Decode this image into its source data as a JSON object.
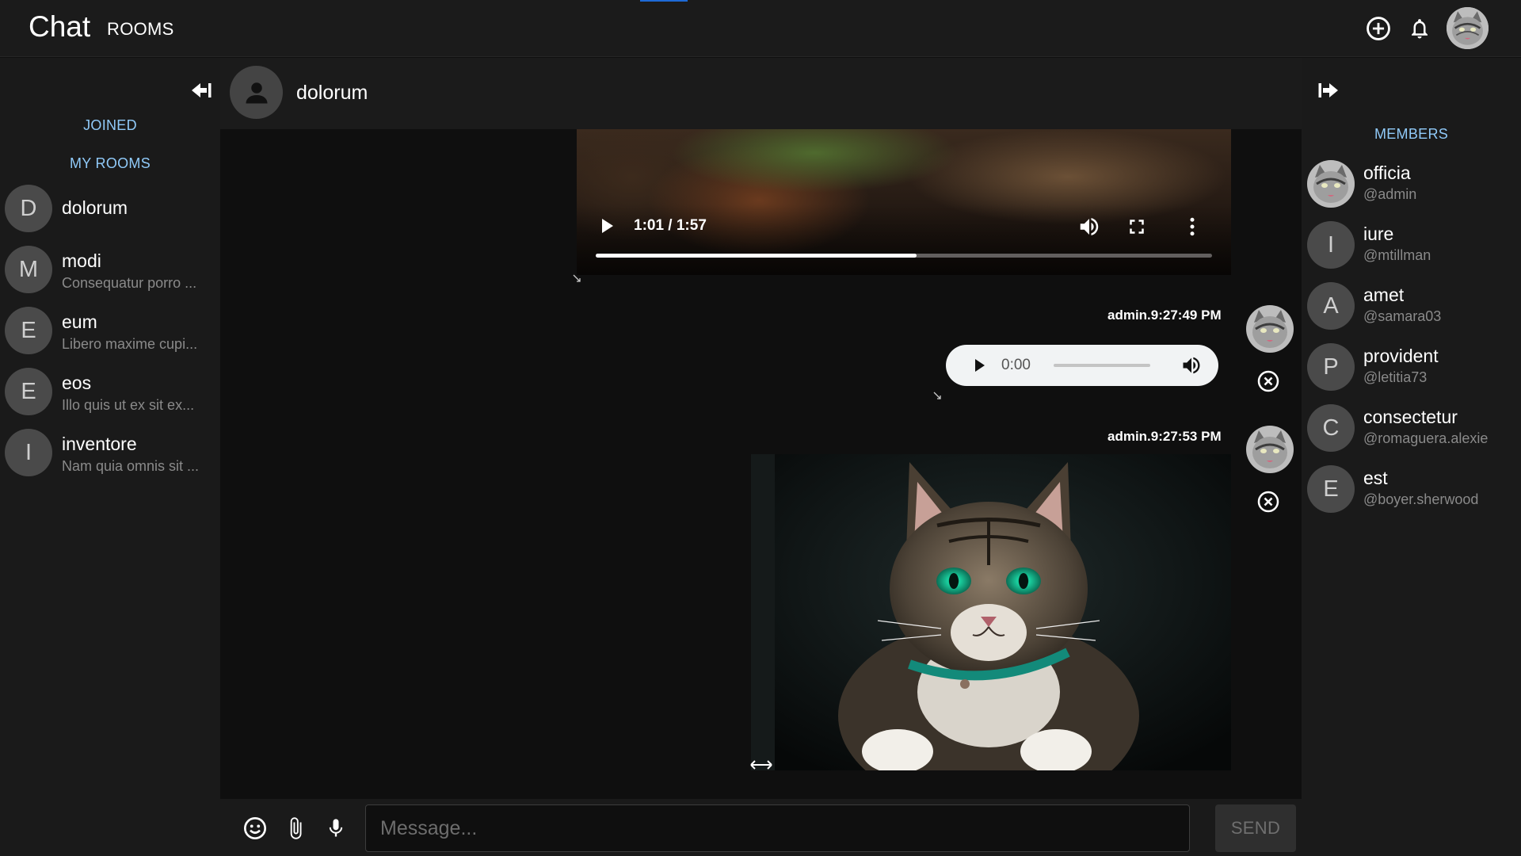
{
  "app": {
    "title": "Chat",
    "rooms_link": "ROOMS"
  },
  "colors": {
    "accent": "#90caf9",
    "background": "#0f0f0f",
    "panel": "#1a1a1a",
    "progress_indicator": "#1e6ad6"
  },
  "icons": {
    "add": "add-circle-icon",
    "notifications": "bell-icon",
    "collapse_left": "arrow-left-to-bar-icon",
    "collapse_right": "arrow-right-to-bar-icon",
    "emoji": "emoji-icon",
    "attach": "paperclip-icon",
    "mic": "microphone-icon"
  },
  "sidebar": {
    "tabs": [
      "JOINED",
      "MY ROOMS"
    ],
    "rooms": [
      {
        "initial": "D",
        "name": "dolorum",
        "preview": ""
      },
      {
        "initial": "M",
        "name": "modi",
        "preview": "Consequatur porro ..."
      },
      {
        "initial": "E",
        "name": "eum",
        "preview": "Libero maxime cupi..."
      },
      {
        "initial": "E",
        "name": "eos",
        "preview": "Illo quis ut ex sit ex..."
      },
      {
        "initial": "I",
        "name": "inventore",
        "preview": "Nam quia omnis sit ..."
      }
    ]
  },
  "chat": {
    "room_name": "dolorum",
    "video": {
      "time": "1:01 / 1:57",
      "progress": 0.52
    },
    "messages": [
      {
        "meta": "admin.9:27:49 PM",
        "type": "audio",
        "time": "0:00"
      },
      {
        "meta": "admin.9:27:53 PM",
        "type": "image"
      }
    ]
  },
  "composer": {
    "placeholder": "Message...",
    "send_label": "SEND"
  },
  "members_panel": {
    "title": "MEMBERS",
    "members": [
      {
        "initial": "",
        "name": "officia",
        "handle": "@admin"
      },
      {
        "initial": "I",
        "name": "iure",
        "handle": "@mtillman"
      },
      {
        "initial": "A",
        "name": "amet",
        "handle": "@samara03"
      },
      {
        "initial": "P",
        "name": "provident",
        "handle": "@letitia73"
      },
      {
        "initial": "C",
        "name": "consectetur",
        "handle": "@romaguera.alexie"
      },
      {
        "initial": "E",
        "name": "est",
        "handle": "@boyer.sherwood"
      }
    ]
  }
}
